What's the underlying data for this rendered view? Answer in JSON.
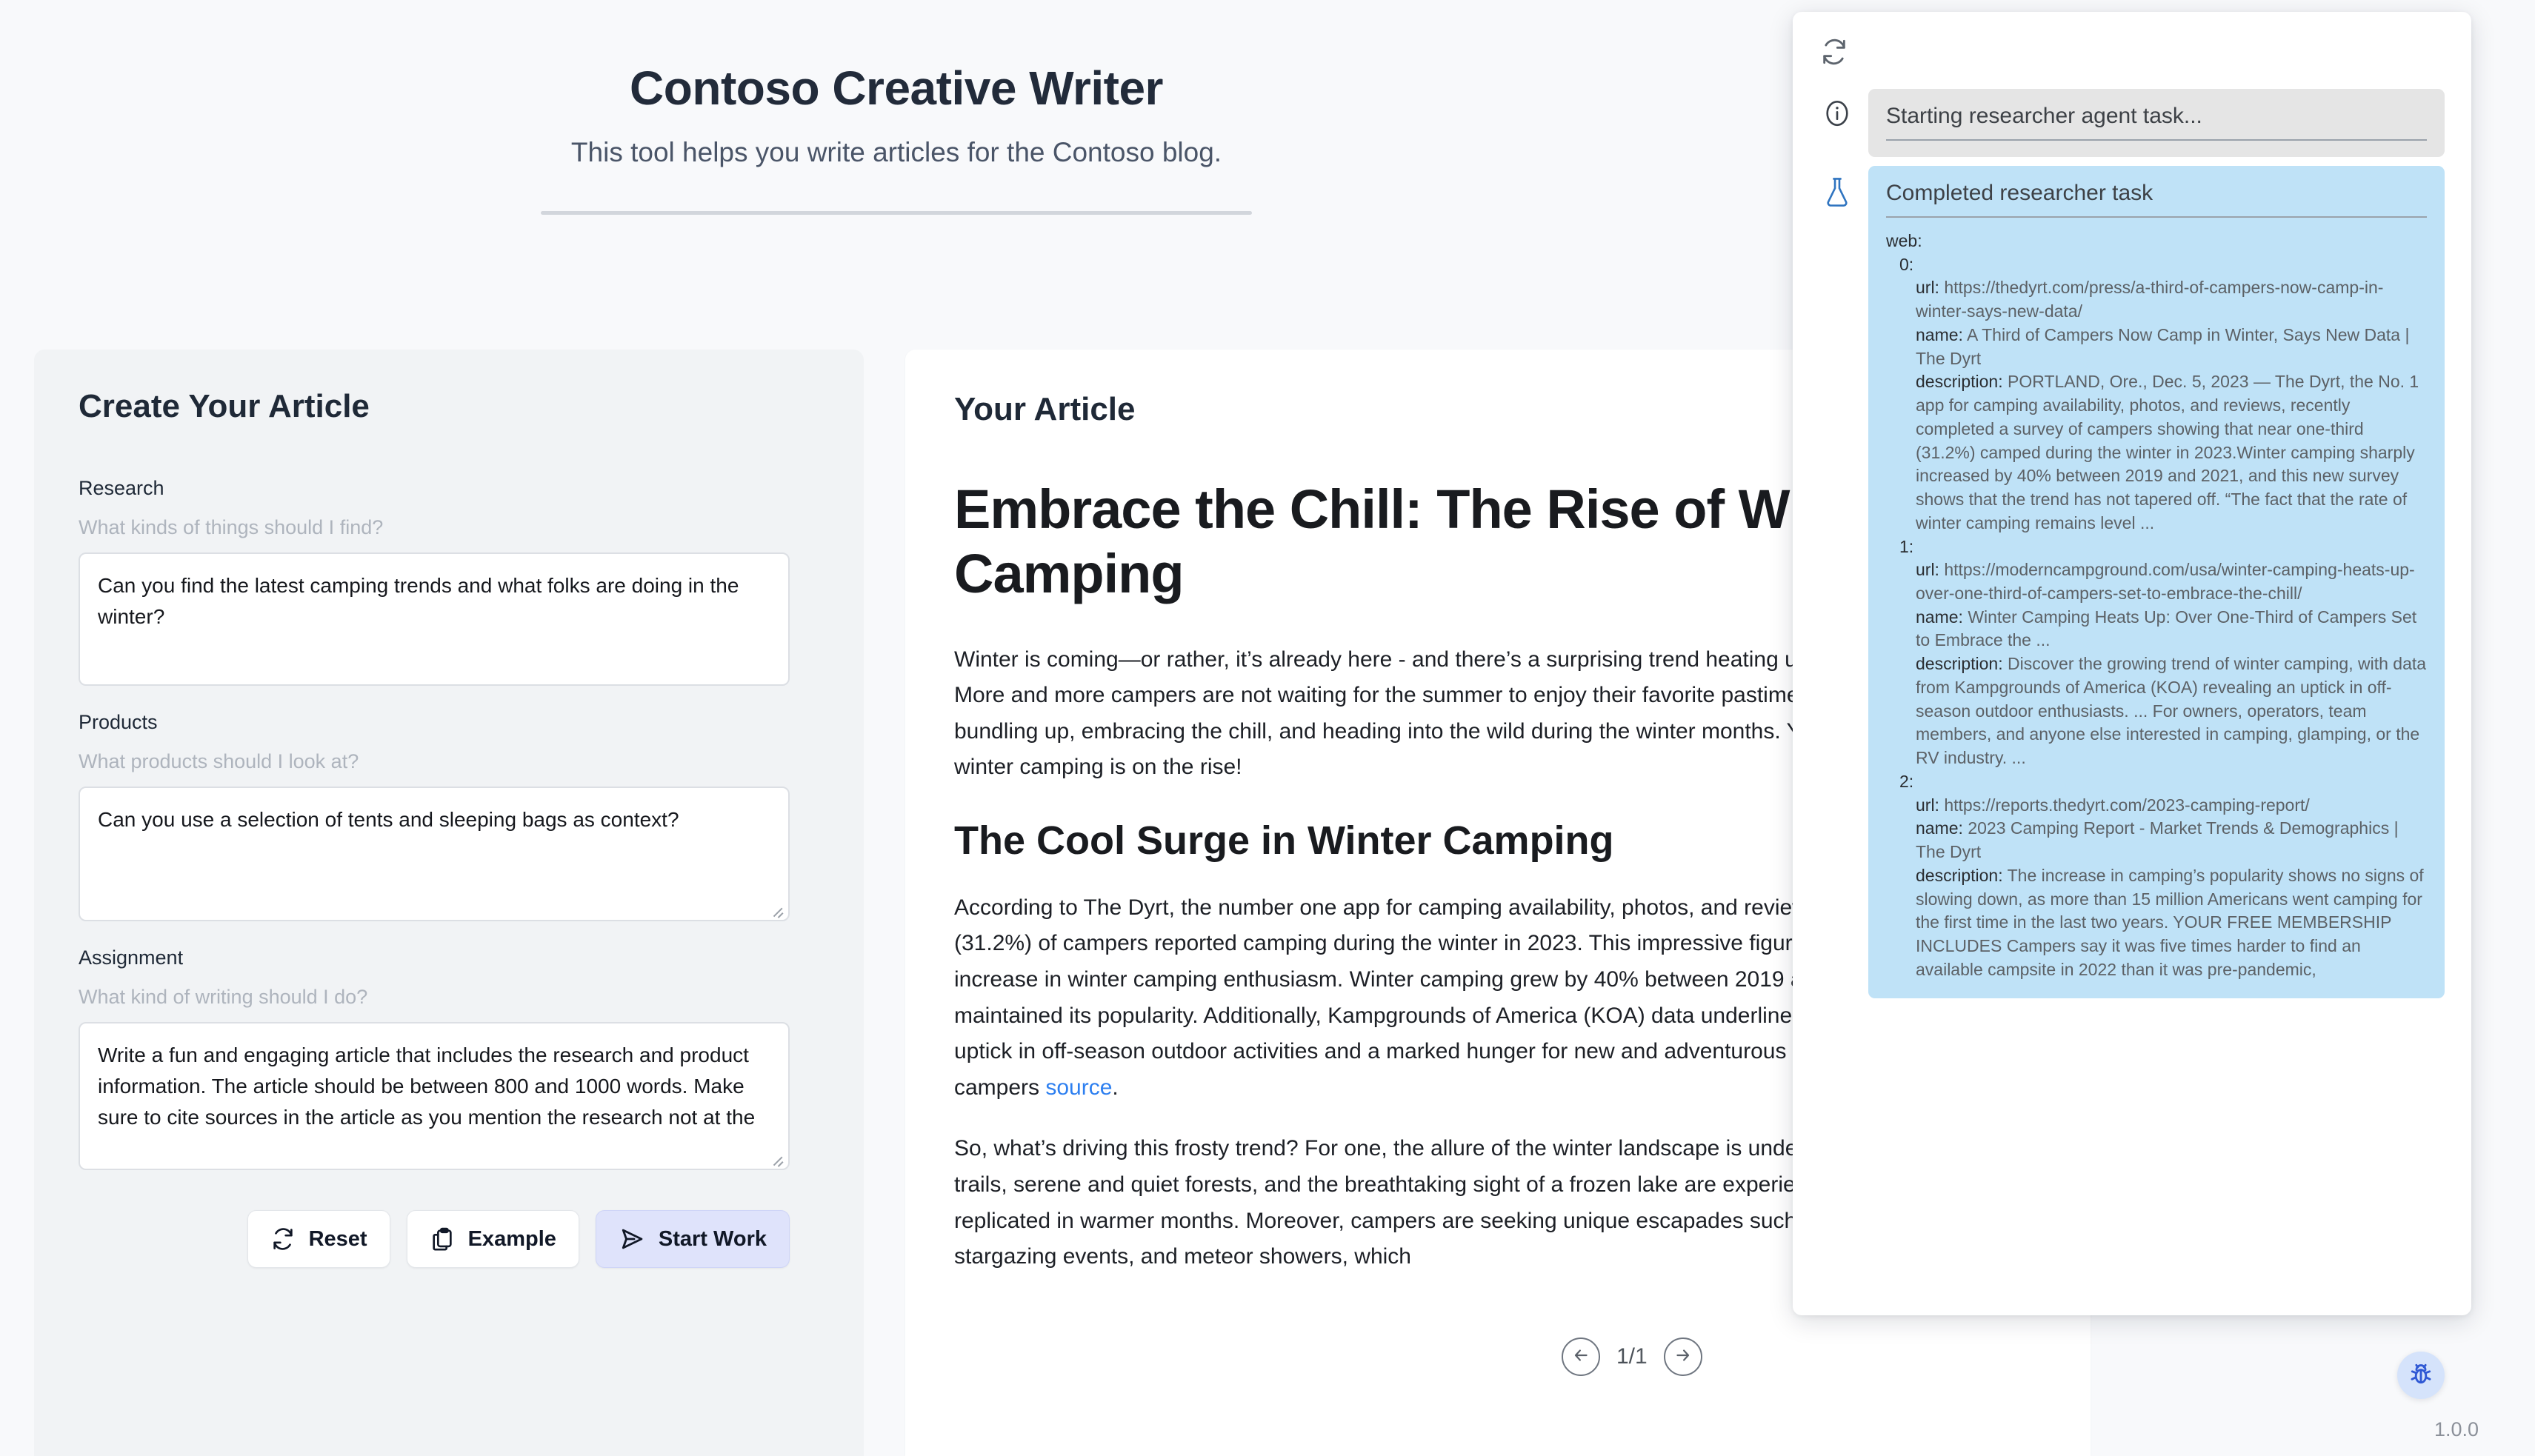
{
  "header": {
    "title": "Contoso Creative Writer",
    "subtitle": "This tool helps you write articles for the Contoso blog."
  },
  "form": {
    "title": "Create Your Article",
    "fields": [
      {
        "label": "Research",
        "hint": "What kinds of things should I find?",
        "value": "Can you find the latest camping trends and what folks are doing in the winter?"
      },
      {
        "label": "Products",
        "hint": "What products should I look at?",
        "value": "Can you use a selection of tents and sleeping bags as context?"
      },
      {
        "label": "Assignment",
        "hint": "What kind of writing should I do?",
        "value": "Write a fun and engaging article that includes the research and product information. The article should be between 800 and 1000 words. Make sure to cite sources in the article as you mention the research not at the"
      }
    ],
    "buttons": {
      "reset": "Reset",
      "example": "Example",
      "start": "Start Work"
    }
  },
  "article": {
    "card_title": "Your Article",
    "h1": "Embrace the Chill: The Rise of Winter Camping",
    "paragraph1": "Winter is coming—or rather, it’s already here - and there’s a surprising trend heating up the outdoor world. More and more campers are not waiting for the summer to enjoy their favorite pastime. Instead, they’re bundling up, embracing the chill, and heading into the wild during the winter months. Yes, you heard that right: winter camping is on the rise!",
    "h2": "The Cool Surge in Winter Camping",
    "paragraph2_before_link": "According to The Dyrt, the number one app for camping availability, photos, and reviews, nearly a third (31.2%) of campers reported camping during the winter in 2023. This impressive figure showcases a sharp increase in winter camping enthusiasm. Winter camping grew by 40% between 2019 and 2021 and has since maintained its popularity. Additionally, Kampgrounds of America (KOA) data underlines this trend, noting an uptick in off-season outdoor activities and a marked hunger for new and adventurous experiences amongst campers ",
    "paragraph2_link": "source",
    "paragraph2_after_link": ".",
    "paragraph3": "So, what’s driving this frosty trend? For one, the allure of the winter landscape is undeniable. Snow-covered trails, serene and quiet forests, and the breathtaking sight of a frozen lake are experiences that can’t be replicated in warmer months. Moreover, campers are seeking unique escapades such as culinary tourism, stargazing events, and meteor showers, which",
    "pagination": {
      "label": "1/1",
      "prev_icon": "arrow-left-icon",
      "next_icon": "arrow-right-icon"
    }
  },
  "side_panel": {
    "refresh_icon": "refresh-icon",
    "messages": [
      {
        "icon": "info-icon",
        "kind": "info",
        "title": "Starting researcher agent task...",
        "body": []
      },
      {
        "icon": "flask-icon",
        "kind": "result",
        "title": "Completed researcher task",
        "body": [
          {
            "indent": 0,
            "key": "web:",
            "value": ""
          },
          {
            "indent": 1,
            "key": "0:",
            "value": ""
          },
          {
            "indent": 2,
            "key": "url:",
            "value": "https://thedyrt.com/press/a-third-of-campers-now-camp-in-winter-says-new-data/"
          },
          {
            "indent": 2,
            "key": "name:",
            "value": "A Third of Campers Now Camp in Winter, Says New Data | The Dyrt"
          },
          {
            "indent": 2,
            "key": "description:",
            "value": "PORTLAND, Ore., Dec. 5, 2023 — The Dyrt, the No. 1 app for camping availability, photos, and reviews, recently completed a survey of campers showing that near one-third (31.2%) camped during the winter in 2023.Winter camping sharply increased by 40% between 2019 and 2021, and this new survey shows that the trend has not tapered off. “The fact that the rate of winter camping remains level ..."
          },
          {
            "indent": 1,
            "key": "1:",
            "value": ""
          },
          {
            "indent": 2,
            "key": "url:",
            "value": "https://moderncampground.com/usa/winter-camping-heats-up-over-one-third-of-campers-set-to-embrace-the-chill/"
          },
          {
            "indent": 2,
            "key": "name:",
            "value": "Winter Camping Heats Up: Over One-Third of Campers Set to Embrace the ..."
          },
          {
            "indent": 2,
            "key": "description:",
            "value": "Discover the growing trend of winter camping, with data from Kampgrounds of America (KOA) revealing an uptick in off-season outdoor enthusiasts. ... For owners, operators, team members, and anyone else interested in camping, glamping, or the RV industry. ..."
          },
          {
            "indent": 1,
            "key": "2:",
            "value": ""
          },
          {
            "indent": 2,
            "key": "url:",
            "value": "https://reports.thedyrt.com/2023-camping-report/"
          },
          {
            "indent": 2,
            "key": "name:",
            "value": "2023 Camping Report - Market Trends & Demographics | The Dyrt"
          },
          {
            "indent": 2,
            "key": "description:",
            "value": "The increase in camping’s popularity shows no signs of slowing down, as more than 15 million Americans went camping for the first time in the last two years. YOUR FREE MEMBERSHIP INCLUDES Campers say it was five times harder to find an available campsite in 2022 than it was pre-pandemic,"
          }
        ]
      }
    ]
  },
  "footer": {
    "debug_icon": "bug-icon",
    "version": "1.0.0"
  },
  "colors": {
    "accent": "#2d7ff0",
    "primary_button_bg": "#dfe3fb",
    "result_bg": "#bfe2f7",
    "info_bg": "#e5e5e5",
    "page_bg": "#f8f9fb"
  }
}
